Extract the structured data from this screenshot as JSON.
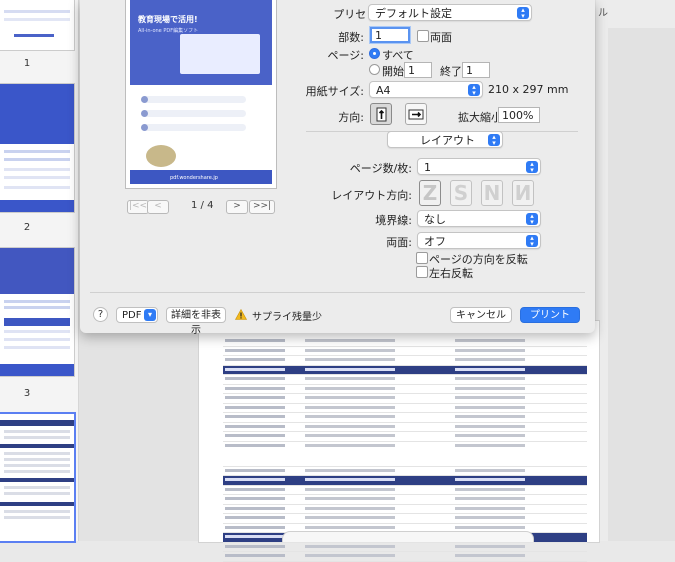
{
  "host": {
    "sidebar_page_numbers": [
      "1",
      "2",
      "3"
    ],
    "cut_text": "ル"
  },
  "dialog": {
    "preview": {
      "title": "教育現場で活用!",
      "subtitle": "All-in-one PDF編集ソフト",
      "footer": "pdf.wondershare.jp",
      "page_indicator": "1 / 4",
      "nav": [
        "|<<",
        "<",
        ">",
        ">>|"
      ]
    },
    "preset": {
      "label": "プリセット:",
      "value": "デフォルト設定"
    },
    "copies": {
      "label": "部数:",
      "value": "1",
      "two_sided_label": "両面"
    },
    "pages": {
      "label": "ページ:",
      "all_label": "すべて",
      "from_label": "開始:",
      "from_value": "1",
      "to_label": "終了:",
      "to_value": "1"
    },
    "paper": {
      "label": "用紙サイズ:",
      "value": "A4",
      "dimensions": "210 x 297 mm"
    },
    "orientation": {
      "label": "方向:",
      "scale_label": "拡大縮小:",
      "scale_value": "100%"
    },
    "section": {
      "value": "レイアウト"
    },
    "layout": {
      "pages_per_sheet": {
        "label": "ページ数/枚:",
        "value": "1"
      },
      "direction": {
        "label": "レイアウト方向:",
        "glyphs": [
          "Z",
          "S",
          "N",
          "N"
        ]
      },
      "border": {
        "label": "境界線:",
        "value": "なし"
      },
      "two_sided": {
        "label": "両面:",
        "value": "オフ"
      },
      "reverse_orientation": "ページの方向を反転",
      "flip_horizontal": "左右反転"
    },
    "footer": {
      "help": "?",
      "pdf": "PDF",
      "hide_details": "詳細を非表示",
      "supply_warning": "サプライ残量少",
      "cancel": "キャンセル",
      "print": "プリント"
    }
  }
}
